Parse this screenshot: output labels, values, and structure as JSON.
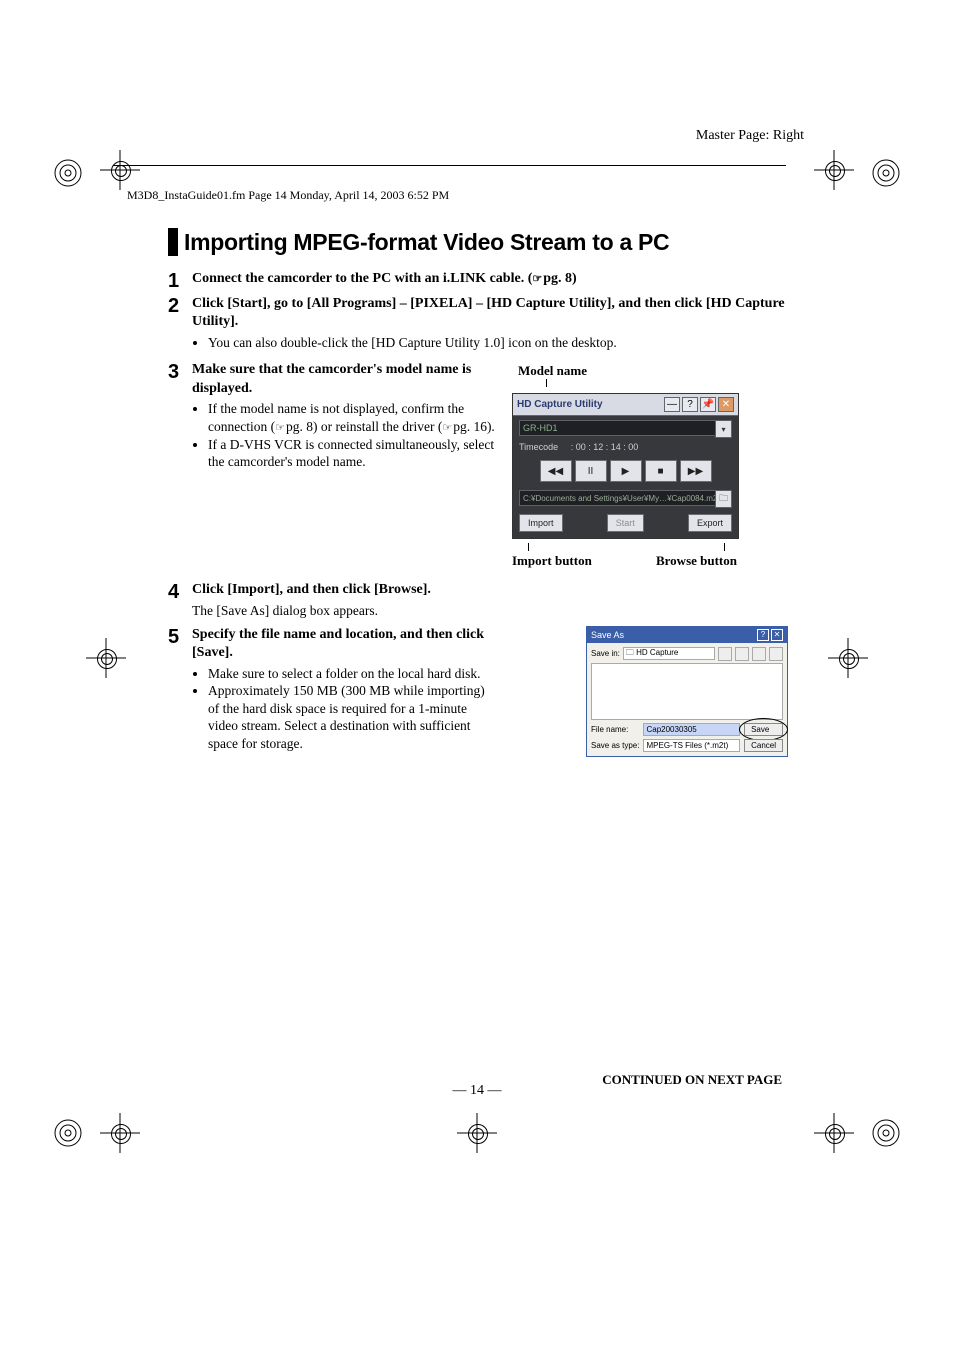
{
  "meta": {
    "master_page": "Master Page: Right",
    "header_line": "M3D8_InstaGuide01.fm  Page 14  Monday, April 14, 2003  6:52 PM"
  },
  "section_title": "Importing MPEG-format Video Stream to a PC",
  "steps": {
    "s1": {
      "num": "1",
      "bold": "Connect the camcorder to the PC with an i.LINK cable. (",
      "ref": "pg. 8)"
    },
    "s2": {
      "num": "2",
      "bold": "Click [Start], go to [All Programs] – [PIXELA] – [HD Capture Utility], and then click [HD Capture Utility].",
      "b1": "You can also double-click the [HD Capture Utility 1.0] icon on the desktop."
    },
    "s3": {
      "num": "3",
      "bold": "Make sure that the camcorder's model name is displayed.",
      "b1a": "If the model name is not displayed, confirm the connection (",
      "b1b": "pg. 8) or reinstall the driver (",
      "b1c": "pg. 16).",
      "b2": "If a D-VHS VCR is connected simultaneously, select the camcorder's model name."
    },
    "s4": {
      "num": "4",
      "bold": "Click [Import], and then click [Browse].",
      "p1": "The [Save As] dialog box appears."
    },
    "s5": {
      "num": "5",
      "bold": "Specify the file name and location, and then click [Save].",
      "b1": "Make sure to select a folder on the local hard disk.",
      "b2": "Approximately 150 MB (300 MB while importing) of the hard disk space is required for a 1-minute video stream. Select a destination with sufficient space for storage."
    }
  },
  "callouts": {
    "model_name": "Model name",
    "import_button": "Import button",
    "browse_button": "Browse button"
  },
  "hdc": {
    "title": "HD Capture Utility",
    "min": "—",
    "help": "?",
    "pin": "📌",
    "close": "✕",
    "model": "GR-HD1",
    "dd": "▾",
    "timecode_label": "Timecode",
    "timecode_value": ": 00 : 12 : 14 : 00",
    "ctrl_rw": "◀◀",
    "ctrl_pause": "II",
    "ctrl_play": "▶",
    "ctrl_stop": "■",
    "ctrl_ff": "▶▶",
    "path": "C:¥Documents and Settings¥User¥My…¥Cap0084.m2t",
    "browse_icon": "🗀",
    "import": "Import",
    "start": "Start",
    "export": "Export"
  },
  "saveas": {
    "title": "Save As",
    "help": "?",
    "close": "✕",
    "savein_label": "Save in:",
    "savein_value": "🗀 HD Capture",
    "nav": "▾",
    "filename_label": "File name:",
    "filename_value": "Cap20030305",
    "saveastype_label": "Save as type:",
    "saveastype_value": "MPEG-TS Files (*.m2t)",
    "save_btn": "Save",
    "cancel_btn": "Cancel"
  },
  "footer": {
    "continued": "CONTINUED ON NEXT PAGE",
    "page_num": "— 14 —"
  }
}
